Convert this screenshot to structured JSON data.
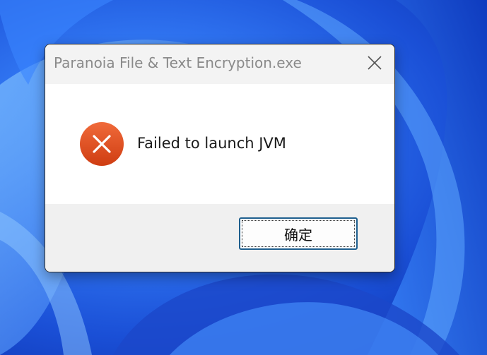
{
  "dialog": {
    "title": "Paranoia File & Text Encryption.exe",
    "close_icon": "close-icon",
    "message": "Failed to launch JVM",
    "status_icon": "error-icon",
    "ok_label": "确定"
  },
  "colors": {
    "error_red": "#e0471a",
    "titlebar_bg": "#f3f3f3",
    "footer_bg": "#f0f0f0",
    "button_border": "#1e5f8e",
    "wallpaper_blue": "#2f73f0"
  }
}
